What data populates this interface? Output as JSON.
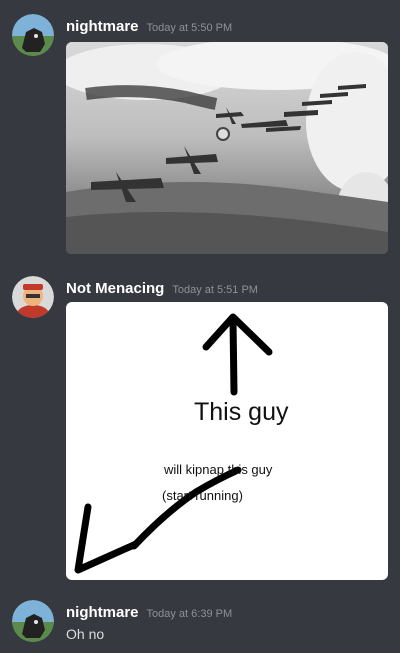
{
  "messages": [
    {
      "author": "nightmare",
      "timestamp": "Today at 5:50 PM",
      "attachment": {
        "type": "photo",
        "subject": "black-and-white aircraft formation"
      }
    },
    {
      "author": "Not Menacing",
      "timestamp": "Today at 5:51 PM",
      "attachment": {
        "type": "meme",
        "big_text": "This guy",
        "line1": "will kipnap this guy",
        "line2": "(start running)"
      }
    },
    {
      "author": "nightmare",
      "timestamp": "Today at 6:39 PM",
      "text": "Oh no"
    }
  ],
  "colors": {
    "background": "#36393f",
    "username": "#ffffff",
    "timestamp": "#8e9297",
    "message_text": "#dcddde"
  }
}
